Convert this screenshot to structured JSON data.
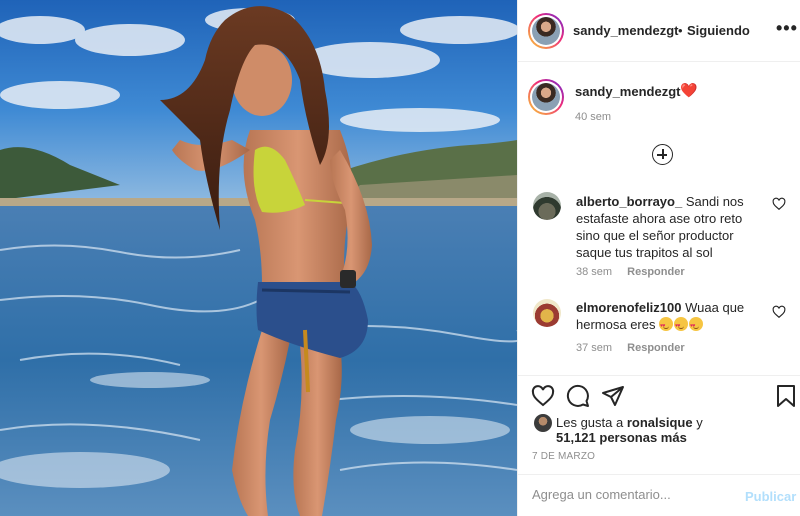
{
  "post": {
    "author": "sandy_mendezgt",
    "follow_dot": "•",
    "follow_status": "Siguiendo",
    "more_label": "•••",
    "caption_emoji": "❤️",
    "caption_time": "40 sem",
    "date": "7 DE MARZO"
  },
  "comments": [
    {
      "user": "alberto_borrayo_",
      "text": "Sandi nos estafaste ahora ase otro reto sino que el señor productor saque tus trapitos al sol",
      "time": "38 sem",
      "reply": "Responder"
    },
    {
      "user": "elmorenofeliz100",
      "text": "Wuaa que hermosa eres",
      "emoji_count": 3,
      "time": "37 sem",
      "reply": "Responder"
    }
  ],
  "likes": {
    "prefix": "Les gusta a",
    "user": "ronalsique",
    "suffix": "y",
    "others": "51,121 personas más"
  },
  "composer": {
    "placeholder": "Agrega un comentario...",
    "publish_label": "Publicar"
  },
  "icons": {
    "load_more": "plus-circle-icon",
    "comment_like": "heart-outline-icon",
    "like": "heart-outline-icon",
    "comment": "speech-bubble-icon",
    "share": "paper-plane-icon",
    "save": "bookmark-icon"
  },
  "colors": {
    "text": "#262626",
    "muted": "#8e8e8e",
    "publish_disabled": "#b2dffc",
    "heart": "#e0245e"
  }
}
